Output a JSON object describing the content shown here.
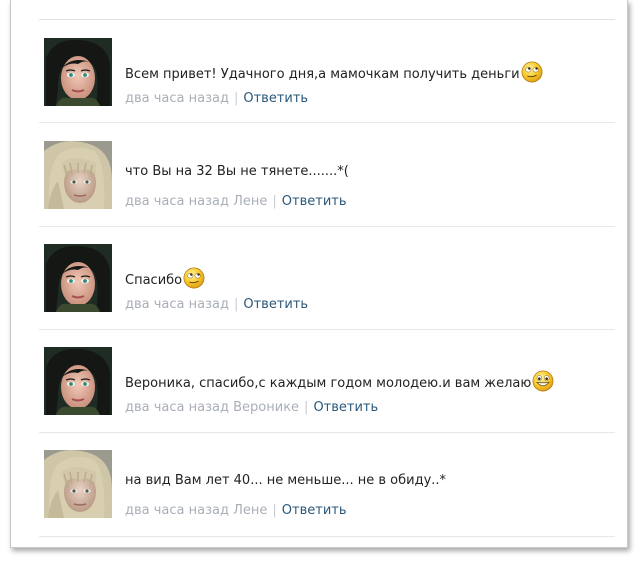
{
  "comments": [
    {
      "avatar": "dark-haired-woman",
      "text": "Всем привет! Удачного дня,а мамочкам получить деньги",
      "emoji": "rolling-eyes-smiley-icon",
      "time": "два часа назад",
      "reply_to": "",
      "reply_label": "Ответить"
    },
    {
      "avatar": "blonde-woman",
      "text": "что Вы на 32 Вы не тянете.......*(",
      "emoji": "",
      "time": "два часа назад",
      "reply_to": "Лене",
      "reply_label": "Ответить"
    },
    {
      "avatar": "dark-haired-woman",
      "text": "Спасибо",
      "emoji": "rolling-eyes-smiley-icon",
      "time": "два часа назад",
      "reply_to": "",
      "reply_label": "Ответить"
    },
    {
      "avatar": "dark-haired-woman",
      "text": "Вероника, спасибо,с каждым годом молодею.и вам желаю",
      "emoji": "grin-smiley-icon",
      "time": "два часа назад",
      "reply_to": "Веронике",
      "reply_label": "Ответить"
    },
    {
      "avatar": "blonde-woman",
      "text": "на вид Вам лет 40... не меньше... не в обиду..*",
      "emoji": "",
      "time": "два часа назад",
      "reply_to": "Лене",
      "reply_label": "Ответить"
    }
  ],
  "separator": "|",
  "colors": {
    "link": "#2b587a",
    "meta": "#a9afb7",
    "text": "#222222",
    "divider": "#e4e7eb"
  }
}
